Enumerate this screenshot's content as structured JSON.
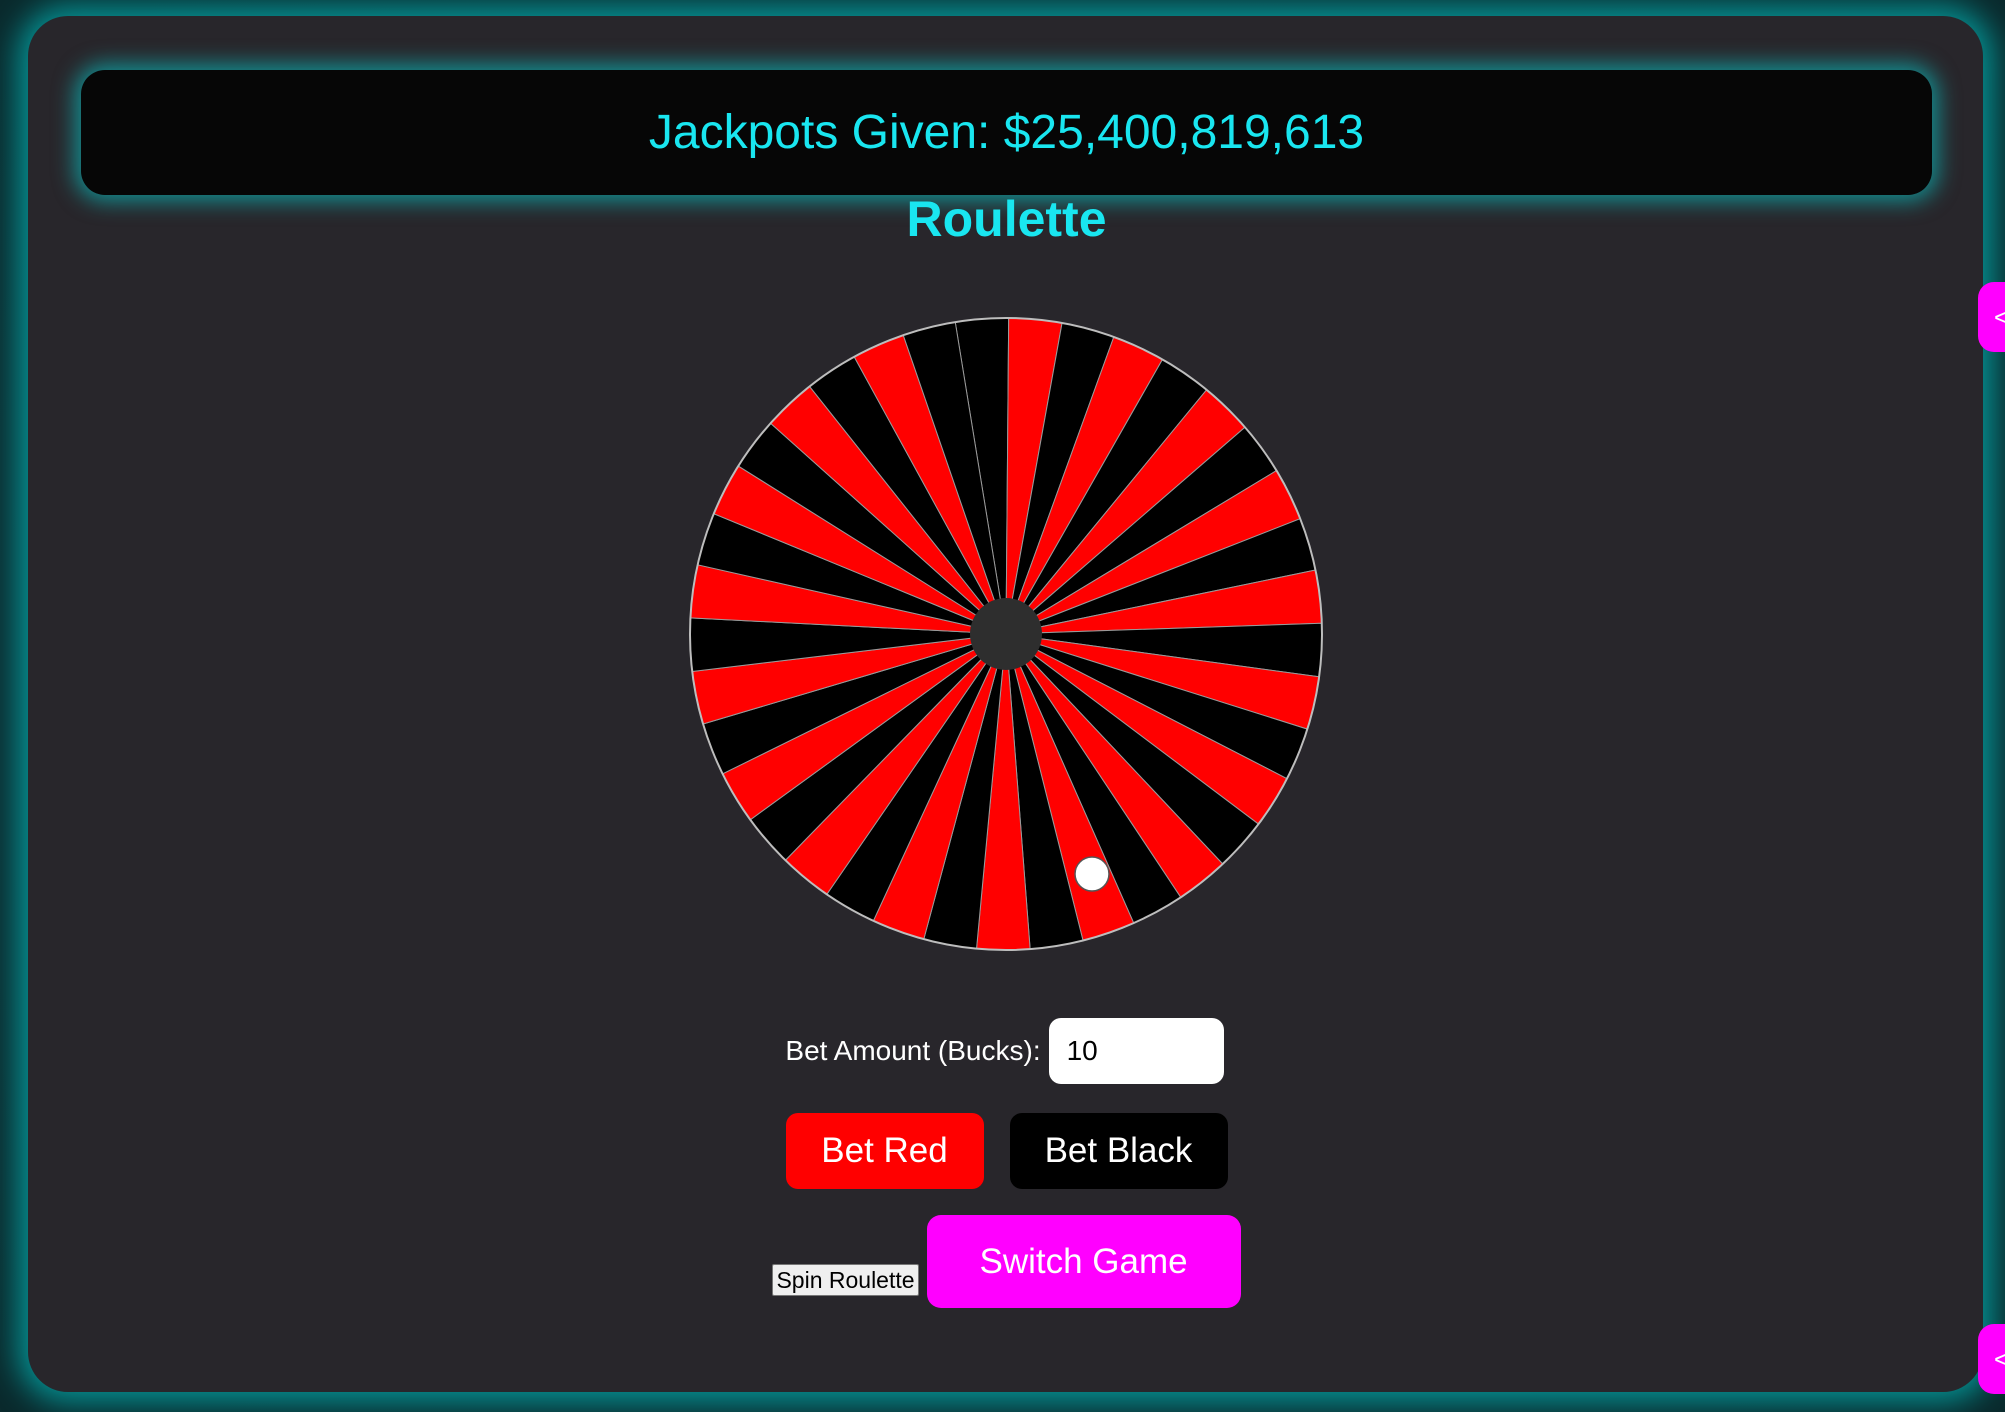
{
  "jackpot": {
    "label": "Jackpots Given: $25,400,819,613"
  },
  "game": {
    "title": "Roulette"
  },
  "wheel": {
    "segments": 37,
    "colors": {
      "red": "#ff0000",
      "black": "#000000",
      "hub": "#2e2e2e",
      "ball": "#ffffff",
      "rim": "#bdbdbd"
    }
  },
  "bet": {
    "label": "Bet Amount (Bucks):",
    "value": "10"
  },
  "buttons": {
    "bet_red": "Bet Red",
    "bet_black": "Bet Black",
    "spin": "Spin Roulette",
    "switch": "Switch Game"
  },
  "side_tabs": {
    "top_icon": "<",
    "bottom_icon": "<"
  },
  "theme": {
    "accent": "#19e6f0",
    "magenta": "#ff00ff",
    "panel": "#28262b"
  }
}
